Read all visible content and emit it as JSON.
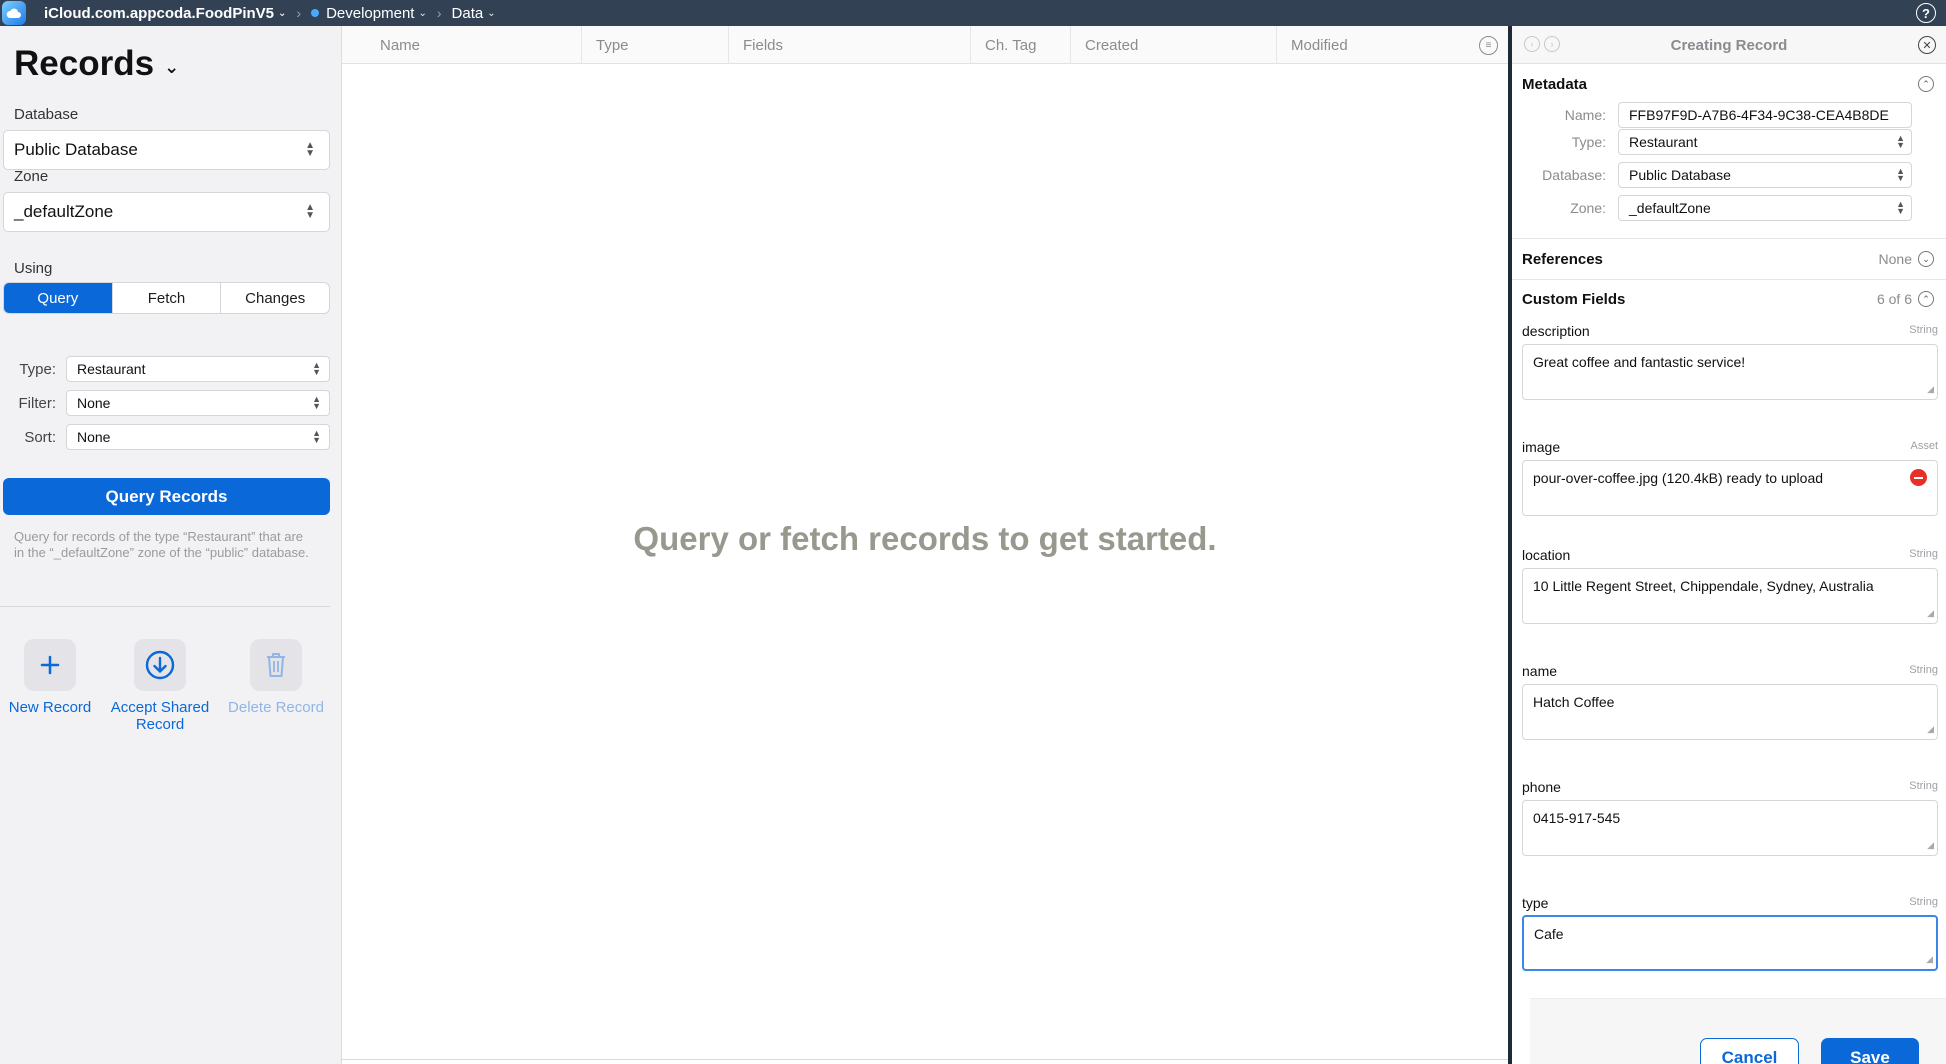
{
  "topbar": {
    "container": "iCloud.com.appcoda.FoodPinV5",
    "environment": "Development",
    "section": "Data",
    "help_icon": "question-circle-icon"
  },
  "sidebar": {
    "title": "Records",
    "database_label": "Database",
    "database_value": "Public Database",
    "zone_label": "Zone",
    "zone_value": "_defaultZone",
    "using_label": "Using",
    "using_options": [
      "Query",
      "Fetch",
      "Changes"
    ],
    "using_selected": "Query",
    "type_label": "Type:",
    "type_value": "Restaurant",
    "filter_label": "Filter:",
    "filter_value": "None",
    "sort_label": "Sort:",
    "sort_value": "None",
    "query_button": "Query Records",
    "query_help": "Query for records of the type “Restaurant” that are in the “_defaultZone” zone of the “public” database.",
    "actions": [
      {
        "label": "New Record",
        "icon": "plus-icon",
        "enabled": true
      },
      {
        "label": "Accept Shared Record",
        "icon": "download-circle-icon",
        "enabled": true
      },
      {
        "label": "Delete Record",
        "icon": "trash-icon",
        "enabled": false
      }
    ]
  },
  "table": {
    "columns": [
      "Name",
      "Type",
      "Fields",
      "Ch. Tag",
      "Created",
      "Modified"
    ],
    "empty_message": "Query or fetch records to get started."
  },
  "inspector": {
    "title": "Creating Record",
    "metadata": {
      "section_title": "Metadata",
      "name_label": "Name:",
      "name_value": "FFB97F9D-A7B6-4F34-9C38-CEA4B8DE",
      "type_label": "Type:",
      "type_value": "Restaurant",
      "database_label": "Database:",
      "database_value": "Public Database",
      "zone_label": "Zone:",
      "zone_value": "_defaultZone"
    },
    "references": {
      "section_title": "References",
      "value": "None"
    },
    "custom_fields": {
      "section_title": "Custom Fields",
      "count": "6 of 6",
      "fields": [
        {
          "name": "description",
          "type": "String",
          "value": "Great coffee and fantastic service!"
        },
        {
          "name": "image",
          "type": "Asset",
          "value": "pour-over-coffee.jpg (120.4kB) ready to upload"
        },
        {
          "name": "location",
          "type": "String",
          "value": "10 Little Regent Street, Chippendale, Sydney, Australia"
        },
        {
          "name": "name",
          "type": "String",
          "value": "Hatch Coffee"
        },
        {
          "name": "phone",
          "type": "String",
          "value": "0415-917-545"
        },
        {
          "name": "type",
          "type": "String",
          "value": "Cafe"
        }
      ]
    },
    "cancel_button": "Cancel",
    "save_button": "Save"
  },
  "colors": {
    "accent": "#0a68d8",
    "topbar": "#334155",
    "danger": "#e8302a"
  }
}
